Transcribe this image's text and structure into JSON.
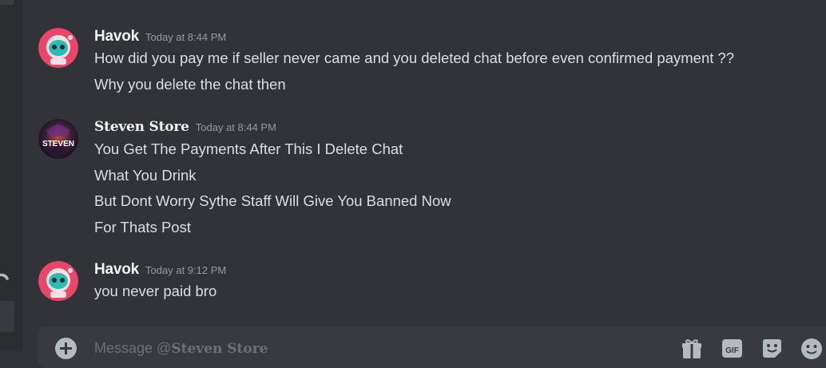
{
  "composer": {
    "placeholder_prefix": "Message @",
    "placeholder_name": "Steven Store",
    "gif_label": "GIF"
  },
  "messages": [
    {
      "author": "Havok",
      "timestamp": "Today at 8:44 PM",
      "lines": [
        "How did you pay me if seller never came and you deleted chat before even confirmed payment ??",
        "Why you delete the chat then"
      ]
    },
    {
      "author": "Steven Store",
      "avatar_text": "STEVEN",
      "timestamp": "Today at 8:44 PM",
      "lines": [
        "You Get The Payments After This I Delete Chat",
        "What You Drink",
        "But Dont Worry Sythe Staff Will Give You Banned Now",
        "For Thats Post"
      ]
    },
    {
      "author": "Havok",
      "timestamp": "Today at 9:12 PM",
      "lines": [
        "you never paid bro"
      ]
    }
  ],
  "colors": {
    "background": "#313338",
    "sidebar": "#2b2d31",
    "text": "#dbdee1",
    "author": "#f2f3f5",
    "timestamp": "#949ba4",
    "havok_avatar_bg": "#e8476c",
    "havok_avatar_face": "#2fb9b0"
  },
  "icons": [
    "phone-hangup-icon",
    "add-attachment-icon",
    "gift-icon",
    "gif-icon",
    "sticker-icon",
    "emoji-icon"
  ]
}
